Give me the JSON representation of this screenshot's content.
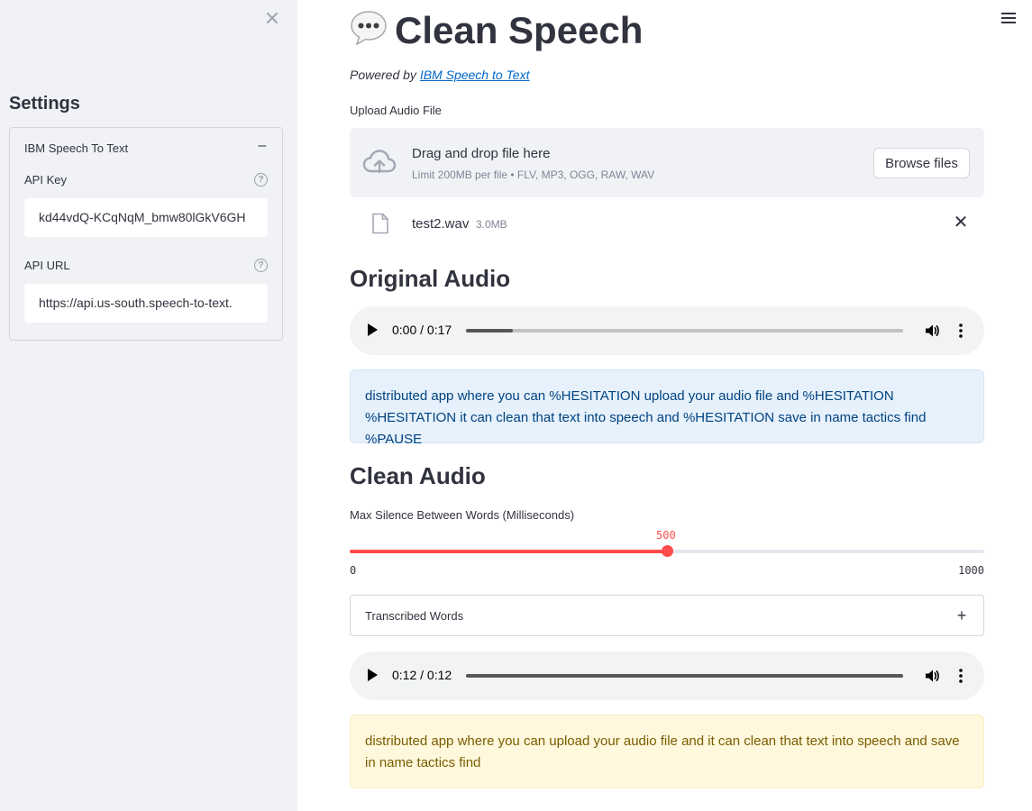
{
  "sidebar": {
    "close_glyph": "✕",
    "title": "Settings",
    "expander": {
      "label": "IBM Speech To Text",
      "toggle": "–",
      "fields": [
        {
          "label": "API Key",
          "value": "kd44vdQ-KCqNqM_bmw80lGkV6GH",
          "help": "?"
        },
        {
          "label": "API URL",
          "value": "https://api.us-south.speech-to-text.",
          "help": "?"
        }
      ]
    }
  },
  "main": {
    "title": "Clean Speech",
    "powered_prefix": "Powered by ",
    "powered_link": "IBM Speech to Text",
    "uploader": {
      "label": "Upload Audio File",
      "drop_title": "Drag and drop file here",
      "drop_sub": "Limit 200MB per file • FLV, MP3, OGG, RAW, WAV",
      "browse_label": "Browse files",
      "file": {
        "name": "test2.wav",
        "size": "3.0MB",
        "remove": "✕"
      }
    },
    "original": {
      "header": "Original Audio",
      "player": {
        "time": "0:00 / 0:17",
        "progress": 0.107
      },
      "transcript": "distributed app where you can %HESITATION upload your audio file and %HESITATION %HESITATION it can clean that text into speech and %HESITATION save in name tactics find %PAUSE"
    },
    "clean": {
      "header": "Clean Audio",
      "slider": {
        "label": "Max Silence Between Words (Milliseconds)",
        "value": 500,
        "min": 0,
        "max": 1000,
        "value_text": "500",
        "min_text": "0",
        "max_text": "1000"
      },
      "words_expander": {
        "label": "Transcribed Words",
        "toggle": "+"
      },
      "player": {
        "time": "0:12 / 0:12",
        "progress": 1.0
      },
      "transcript": "distributed app where you can upload your audio file and it can clean that text into speech and save in name tactics find"
    }
  },
  "colors": {
    "accent": "#ff4b4b",
    "link": "#0068c9",
    "sidebar_bg": "#f0f2f6"
  }
}
